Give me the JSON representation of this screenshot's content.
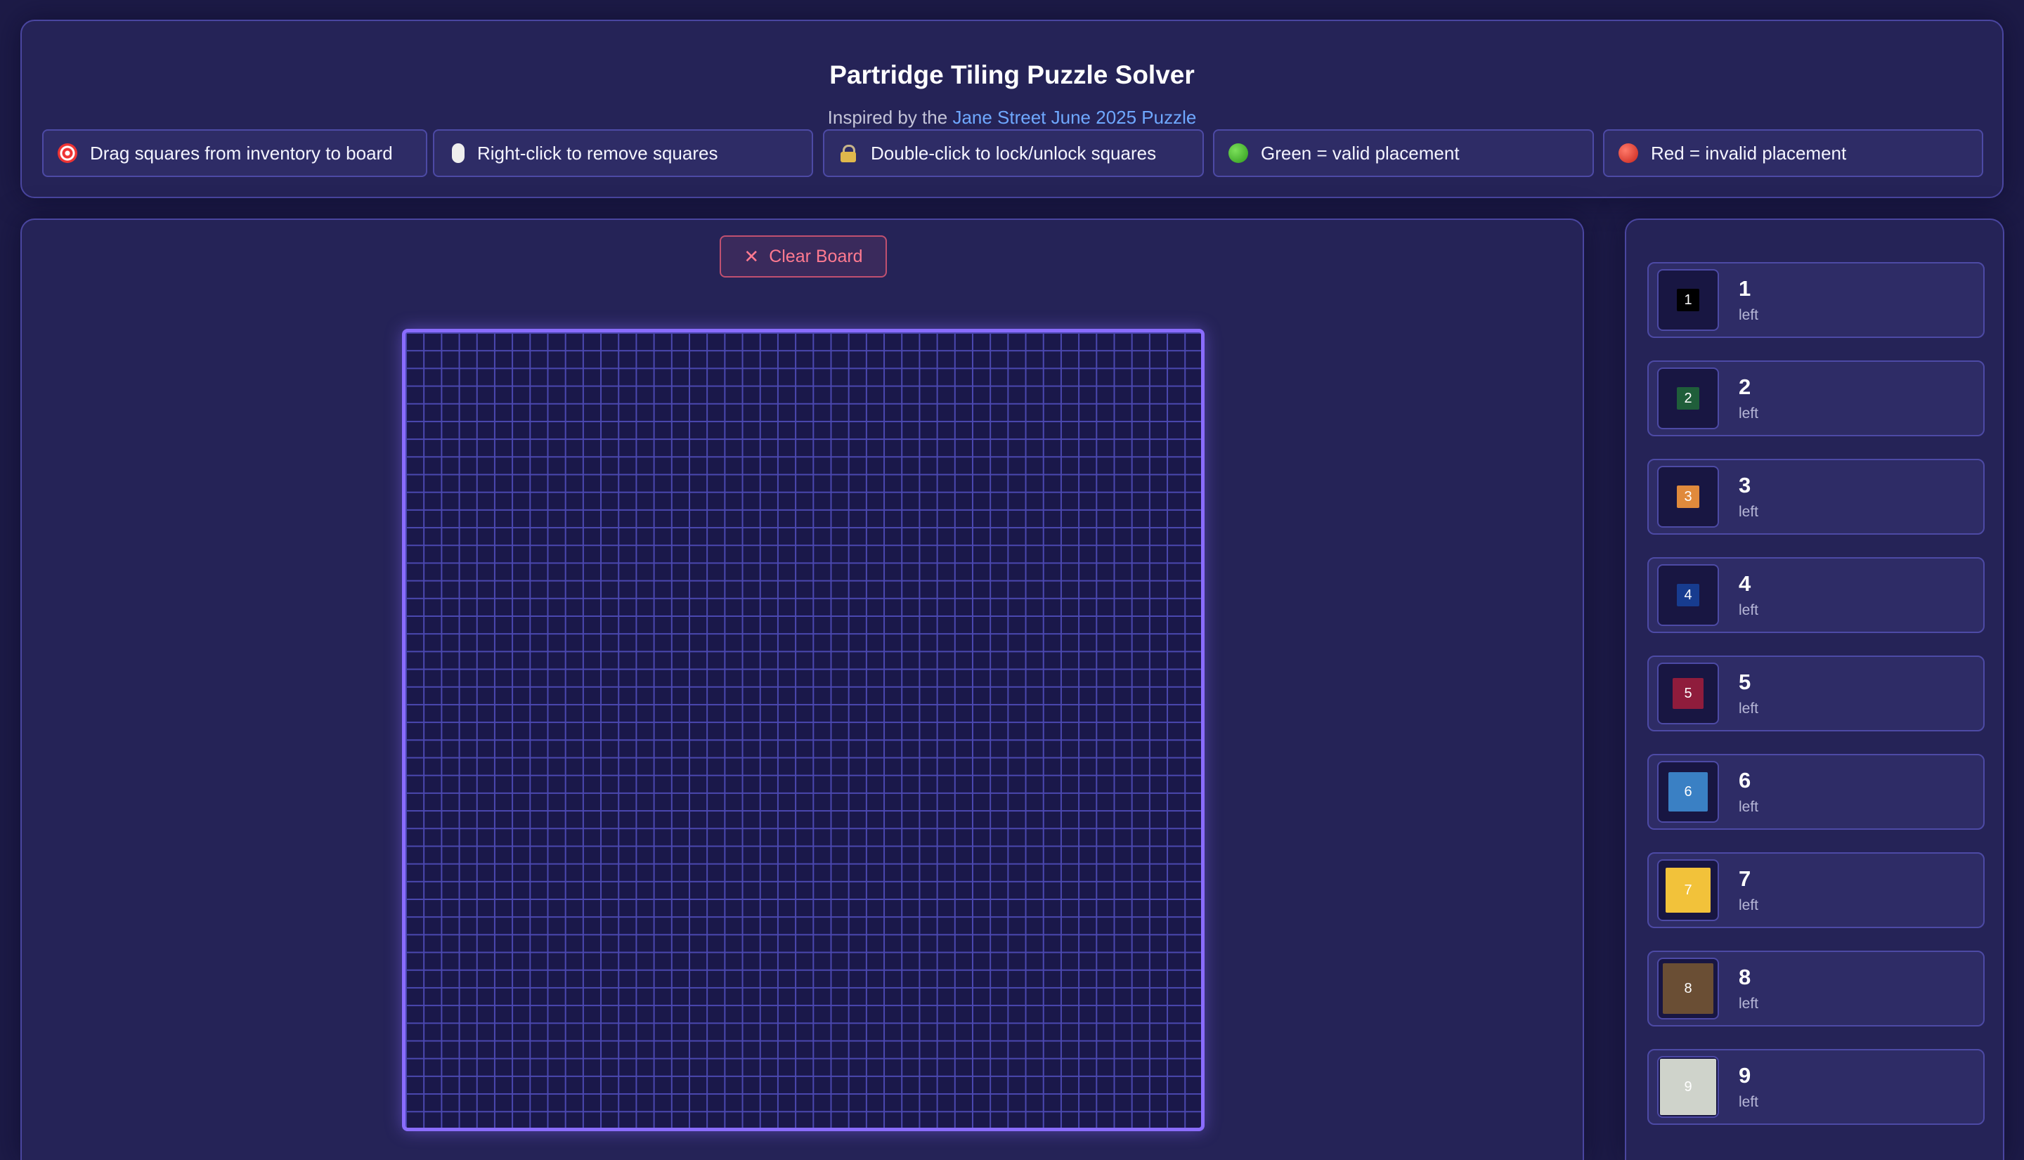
{
  "header": {
    "title": "Partridge Tiling Puzzle Solver",
    "subtitle_prefix": "Inspired by the ",
    "subtitle_link": "Jane Street June 2025 Puzzle",
    "tips": [
      {
        "icon": "target-icon",
        "text": "Drag squares from inventory to board"
      },
      {
        "icon": "mouse-icon",
        "text": "Right-click to remove squares"
      },
      {
        "icon": "lock-icon",
        "text": "Double-click to lock/unlock squares"
      },
      {
        "icon": "green-circle-icon",
        "text": "Green = valid placement"
      },
      {
        "icon": "red-circle-icon",
        "text": "Red = invalid placement"
      }
    ]
  },
  "board": {
    "clear_label": "Clear Board",
    "grid_size": 45
  },
  "inventory": {
    "left_label": "left",
    "items": [
      {
        "size": "1",
        "count": "1",
        "color": "#000000"
      },
      {
        "size": "2",
        "count": "2",
        "color": "#1f5e3a"
      },
      {
        "size": "3",
        "count": "3",
        "color": "#e08a3c"
      },
      {
        "size": "4",
        "count": "4",
        "color": "#173c8f"
      },
      {
        "size": "5",
        "count": "5",
        "color": "#8f1c3c"
      },
      {
        "size": "6",
        "count": "6",
        "color": "#3a80c4"
      },
      {
        "size": "7",
        "count": "7",
        "color": "#f2c23a"
      },
      {
        "size": "8",
        "count": "8",
        "color": "#6a4e34"
      },
      {
        "size": "9",
        "count": "9",
        "color": "#cfd3cb"
      }
    ]
  }
}
